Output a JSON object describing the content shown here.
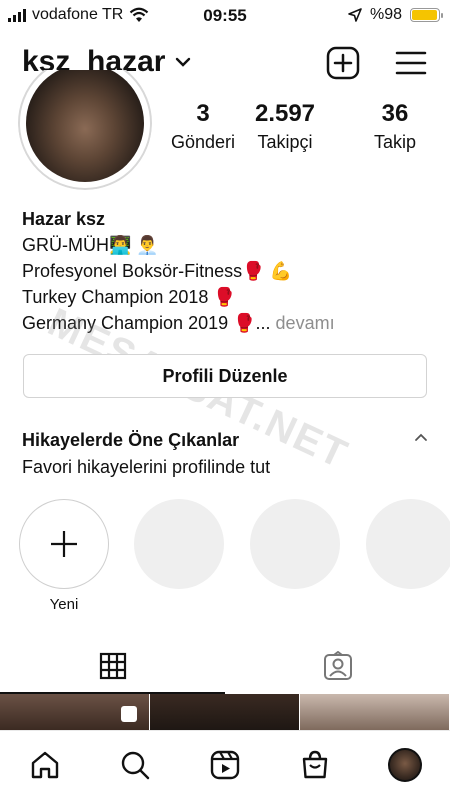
{
  "status_bar": {
    "carrier": "vodafone TR",
    "time": "09:55",
    "battery": "%98",
    "battery_color": "#f5c400",
    "battery_level": 0.98
  },
  "header": {
    "username": "ksz_hazar",
    "add_icon": "plus-square-icon",
    "menu_icon": "hamburger-menu-icon"
  },
  "stats": [
    {
      "value": "3",
      "label": "Gönderi"
    },
    {
      "value": "2.597",
      "label": "Takipçi"
    },
    {
      "value": "36",
      "label": "Takip"
    }
  ],
  "bio": {
    "name": "Hazar ksz",
    "lines": [
      "GRÜ-MÜH👨‍💻 👨‍💼",
      "Profesyonel Boksör-Fitness🥊 💪",
      "Turkey Champion 2018 🥊",
      "Germany Champion 2019 🥊..."
    ],
    "more_label": "devamı"
  },
  "edit_button": "Profili Düzenle",
  "highlights": {
    "title": "Hikayelerde Öne Çıkanlar",
    "subtitle": "Favori hikayelerini profilinde tut",
    "new_label": "Yeni"
  },
  "tabs": [
    {
      "icon": "grid-icon",
      "active": true
    },
    {
      "icon": "tagged-icon",
      "active": false
    }
  ],
  "watermark": "MESAJSAT.NET",
  "nav": [
    "home-icon",
    "search-icon",
    "reels-icon",
    "shop-icon",
    "profile-avatar"
  ]
}
